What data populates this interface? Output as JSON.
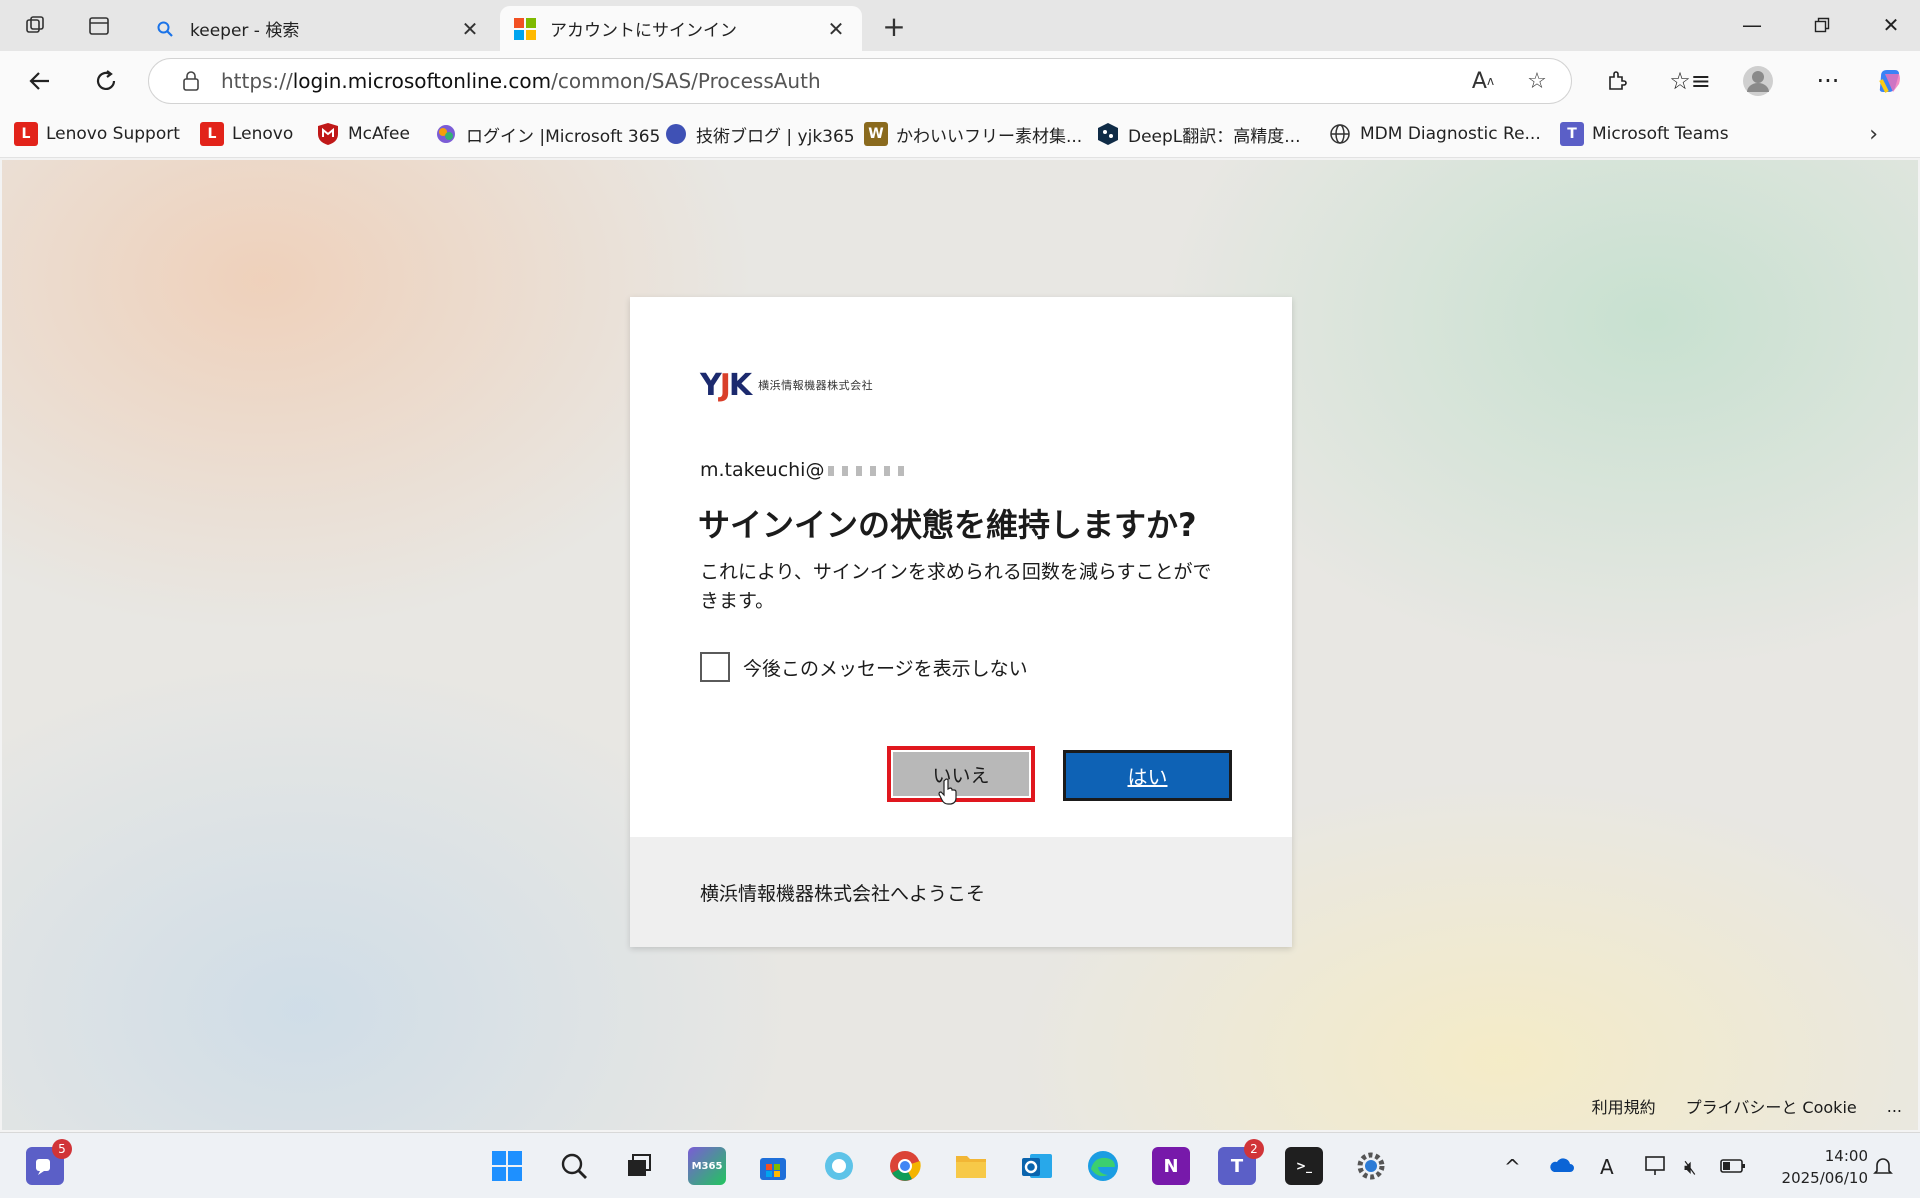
{
  "browser": {
    "tabs": [
      {
        "title": "keeper - 検索",
        "icon": "search-icon"
      },
      {
        "title": "アカウントにサインイン",
        "icon": "microsoft-logo-icon"
      }
    ],
    "url_prefix": "https://",
    "url_host": "login.microsoftonline.com",
    "url_path": "/common/SAS/ProcessAuth"
  },
  "bookmarks": [
    {
      "label": "Lenovo Support",
      "color": "#e2231a",
      "glyph": "L"
    },
    {
      "label": "Lenovo",
      "color": "#e2231a",
      "glyph": "L"
    },
    {
      "label": "McAfee",
      "color": "#c01818",
      "glyph": "M"
    },
    {
      "label": "ログイン |Microsoft 365",
      "color": "#7b5cd6",
      "glyph": "●"
    },
    {
      "label": "技術ブログ | yjk365",
      "color": "#3f51b5",
      "glyph": "●"
    },
    {
      "label": "かわいいフリー素材集...",
      "color": "#b8860b",
      "glyph": "W"
    },
    {
      "label": "DeepL翻訳：高精度...",
      "color": "#0f2b46",
      "glyph": "◆"
    },
    {
      "label": "MDM Diagnostic Re...",
      "color": "#555555",
      "glyph": "⊕"
    },
    {
      "label": "Microsoft Teams",
      "color": "#5b5fc7",
      "glyph": "T"
    }
  ],
  "signin": {
    "org_logo_text": "YJK",
    "org_logo_subtitle": "横浜情報機器株式会社",
    "account": "m.takeuchi@",
    "heading": "サインインの状態を維持しますか?",
    "description": "これにより、サインインを求められる回数を減らすことができます。",
    "checkbox_label": "今後このメッセージを表示しない",
    "no_button": "いいえ",
    "yes_button": "はい",
    "footer_welcome": "横浜情報機器株式会社へようこそ"
  },
  "page_footer": {
    "terms": "利用規約",
    "privacy": "プライバシーと Cookie",
    "more": "..."
  },
  "taskbar": {
    "badge_left": "5",
    "badge_teams": "2",
    "time": "14:00",
    "date": "2025/06/10"
  },
  "colors": {
    "primary_button": "#0e62b5",
    "secondary_button": "#b8b8b8",
    "highlight_outline": "#e0171e"
  }
}
